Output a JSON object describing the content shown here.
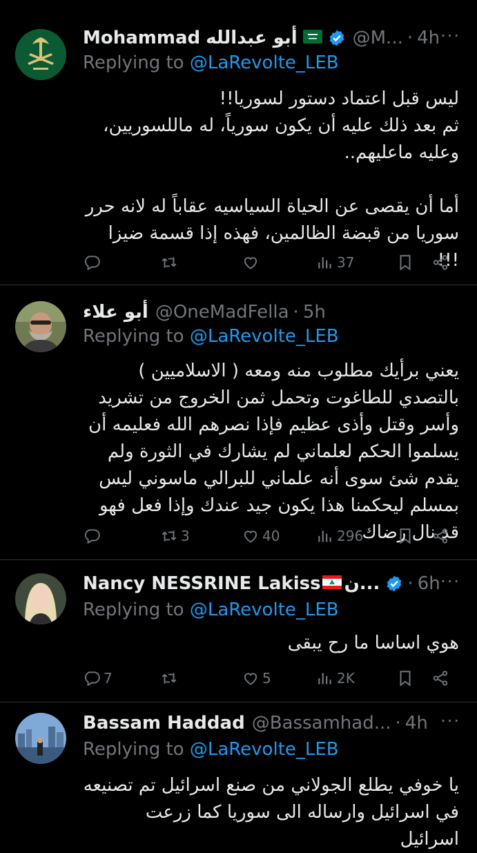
{
  "tweets": [
    {
      "name": "Mohammad",
      "name_ar": "أبو عبدالله",
      "flag": "saudi",
      "verified": true,
      "handle": "@M...",
      "time": "4h",
      "replying_label": "Replying to",
      "replying_to": "@LaRevolte_LEB",
      "text": "ليس قبل اعتماد دستور لسوريا!!\nثم بعد ذلك عليه أن يكون سورياً، له ماللسوريين، وعليه ماعليهم..\n\nأما أن يقصى عن الحياة السياسيه عقاباً له لانه حرر سوريا من قبضة الظالمين، فهذه إذا قسمة ضيزا !!!",
      "stats": {
        "replies": "",
        "reposts": "",
        "likes": "",
        "views": "37"
      }
    },
    {
      "name": "أبو علاء",
      "verified": false,
      "handle": "@OneMadFella",
      "time": "5h",
      "replying_label": "Replying to",
      "replying_to": "@LaRevolte_LEB",
      "text": "يعني برأيك مطلوب منه ومعه ( الاسلاميين ) بالتصدي للطاغوت وتحمل ثمن الخروج من تشريد وأسر وقتل وأذى عظيم فإذا نصرهم الله فعليمه أن يسلموا الحكم لعلماني لم يشارك في الثورة ولم يقدم شئ سوى أنه علماني للبرالي ماسوني ليس بمسلم ليحكمنا هذا يكون جيد عندك وإذا فعل فهو قد نال رضاك",
      "stats": {
        "replies": "",
        "reposts": "3",
        "likes": "40",
        "views": "296"
      }
    },
    {
      "name": "Nancy NESSRINE Lakiss",
      "name_suffix": "ن...",
      "flag": "lebanon",
      "verified": true,
      "handle": "",
      "time": "6h",
      "replying_label": "Replying to",
      "replying_to": "@LaRevolte_LEB",
      "text": "هوي اساسا ما رح يبقى",
      "stats": {
        "replies": "7",
        "reposts": "",
        "likes": "5",
        "views": "2K"
      }
    },
    {
      "name": "Bassam Haddad",
      "verified": false,
      "handle": "@Bassamhad...",
      "time": "4h",
      "replying_label": "Replying to",
      "replying_to": "@LaRevolte_LEB",
      "text": "يا خوفي يطلع الجولاني من صنع اسرائيل تم تصنيعه في اسرائيل وارساله الى سوريا كما زرعت اسرائيل",
      "stats": {
        "replies": "",
        "reposts": "",
        "likes": "",
        "views": ""
      }
    }
  ],
  "colors": {
    "background": "#000000",
    "text": "#e7e9ea",
    "muted": "#71767b",
    "link": "#1d9bf0",
    "verified": "#1d9bf0",
    "divider": "#2f3336"
  }
}
